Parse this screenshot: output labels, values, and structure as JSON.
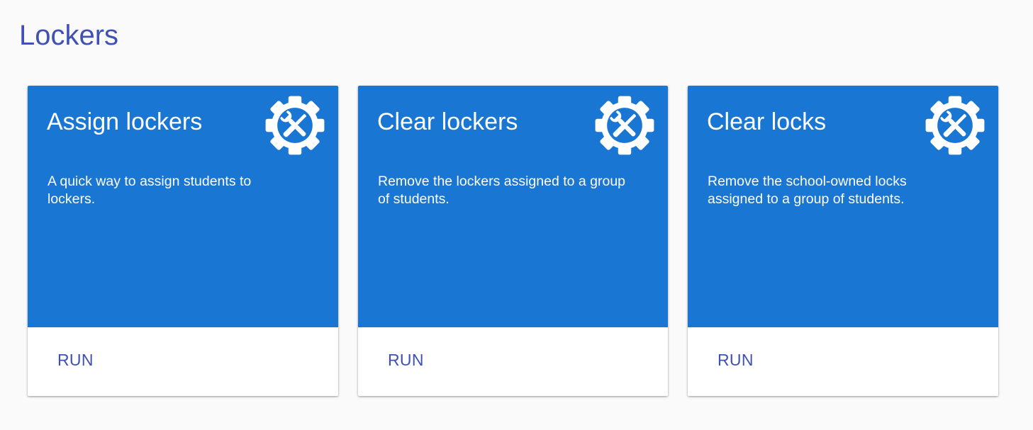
{
  "page": {
    "title": "Lockers"
  },
  "theme": {
    "card_color": "#1976d2",
    "accent_color": "#3f51b5"
  },
  "cards": [
    {
      "title": "Assign lockers",
      "description": "A quick way to assign students to lockers.",
      "icon": "gear-tools-icon",
      "action_label": "RUN"
    },
    {
      "title": "Clear lockers",
      "description": "Remove the lockers assigned to a group of students.",
      "icon": "gear-tools-icon",
      "action_label": "RUN"
    },
    {
      "title": "Clear locks",
      "description": "Remove the school-owned locks assigned to a group of students.",
      "icon": "gear-tools-icon",
      "action_label": "RUN"
    }
  ]
}
